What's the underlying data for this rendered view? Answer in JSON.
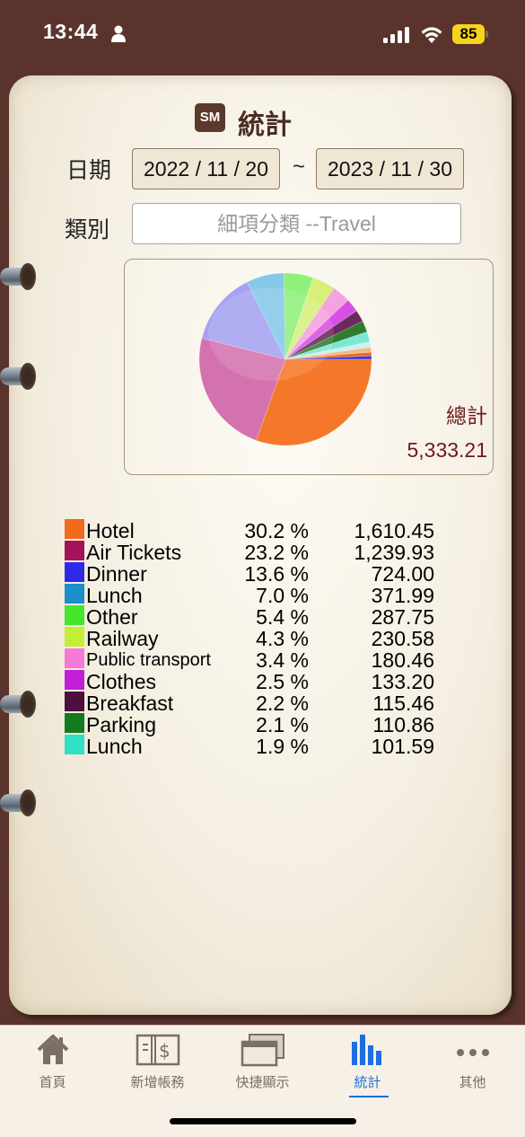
{
  "status_bar": {
    "time": "13:44",
    "battery": "85"
  },
  "app_icon": "SM",
  "title": "統計",
  "date_label": "日期",
  "date_from": "2022 / 11 / 20",
  "date_separator": "~",
  "date_to": "2023 / 11 / 30",
  "category_label": "類別",
  "category_value": "細項分類 --Travel",
  "total_label": "總計",
  "total_value": "5,333.21",
  "chart_data": {
    "type": "pie",
    "slices": [
      {
        "name": "Hotel",
        "percent": 30.2,
        "amount": "1,610.45",
        "color": "#f5782a"
      },
      {
        "name": "Air Tickets",
        "percent": 23.2,
        "amount": "1,239.93",
        "color": "#d472b0"
      },
      {
        "name": "Dinner",
        "percent": 13.6,
        "amount": "724.00",
        "color": "#a6a2f2"
      },
      {
        "name": "Lunch",
        "percent": 7.0,
        "amount": "371.99",
        "color": "#86c8e8"
      },
      {
        "name": "Other",
        "percent": 5.4,
        "amount": "287.75",
        "color": "#8ff07a"
      },
      {
        "name": "Railway",
        "percent": 4.3,
        "amount": "230.58",
        "color": "#d7f07a"
      },
      {
        "name": "Public transport",
        "percent": 3.4,
        "amount": "180.46",
        "color": "#f5a3de"
      },
      {
        "name": "Clothes",
        "percent": 2.5,
        "amount": "133.20",
        "color": "#d84fe8"
      },
      {
        "name": "Breakfast",
        "percent": 2.2,
        "amount": "115.46",
        "color": "#6b2a5c"
      },
      {
        "name": "Parking",
        "percent": 2.1,
        "amount": "110.86",
        "color": "#2e7d2e"
      },
      {
        "name": "Lunch",
        "percent": 1.9,
        "amount": "101.59",
        "color": "#7de8d2"
      },
      {
        "name": "",
        "percent": 1.0,
        "amount": "",
        "color": "#c9f3ef"
      },
      {
        "name": "",
        "percent": 0.9,
        "amount": "",
        "color": "#f5b98a"
      },
      {
        "name": "",
        "percent": 0.7,
        "amount": "",
        "color": "#ef6a1a"
      },
      {
        "name": "",
        "percent": 0.6,
        "amount": "",
        "color": "#3a3ad8"
      }
    ]
  },
  "legend": [
    {
      "name": "Hotel",
      "pct": "30.2 %",
      "amount": "1,610.45",
      "color": "#f26a1b"
    },
    {
      "name": "Air Tickets",
      "pct": "23.2 %",
      "amount": "1,239.93",
      "color": "#a3125a"
    },
    {
      "name": "Dinner",
      "pct": "13.6 %",
      "amount": "724.00",
      "color": "#2f2ae8"
    },
    {
      "name": "Lunch",
      "pct": "7.0 %",
      "amount": "371.99",
      "color": "#1b8fc9"
    },
    {
      "name": "Other",
      "pct": "5.4 %",
      "amount": "287.75",
      "color": "#44e52c"
    },
    {
      "name": "Railway",
      "pct": "4.3 %",
      "amount": "230.58",
      "color": "#c4ee36"
    },
    {
      "name": "Public transport",
      "pct": "3.4 %",
      "amount": "180.46",
      "color": "#f57ad6"
    },
    {
      "name": "Clothes",
      "pct": "2.5 %",
      "amount": "133.20",
      "color": "#c21fd8"
    },
    {
      "name": "Breakfast",
      "pct": "2.2 %",
      "amount": "115.46",
      "color": "#4d0f3d"
    },
    {
      "name": "Parking",
      "pct": "2.1 %",
      "amount": "110.86",
      "color": "#137a1f"
    },
    {
      "name": "Lunch",
      "pct": "1.9 %",
      "amount": "101.59",
      "color": "#2fe0c7"
    }
  ],
  "tabs": [
    {
      "label": "首頁",
      "icon": "home-icon"
    },
    {
      "label": "新增帳務",
      "icon": "add-entry-icon"
    },
    {
      "label": "快捷顯示",
      "icon": "quick-view-icon"
    },
    {
      "label": "統計",
      "icon": "stats-icon",
      "active": true
    },
    {
      "label": "其他",
      "icon": "more-icon"
    }
  ]
}
